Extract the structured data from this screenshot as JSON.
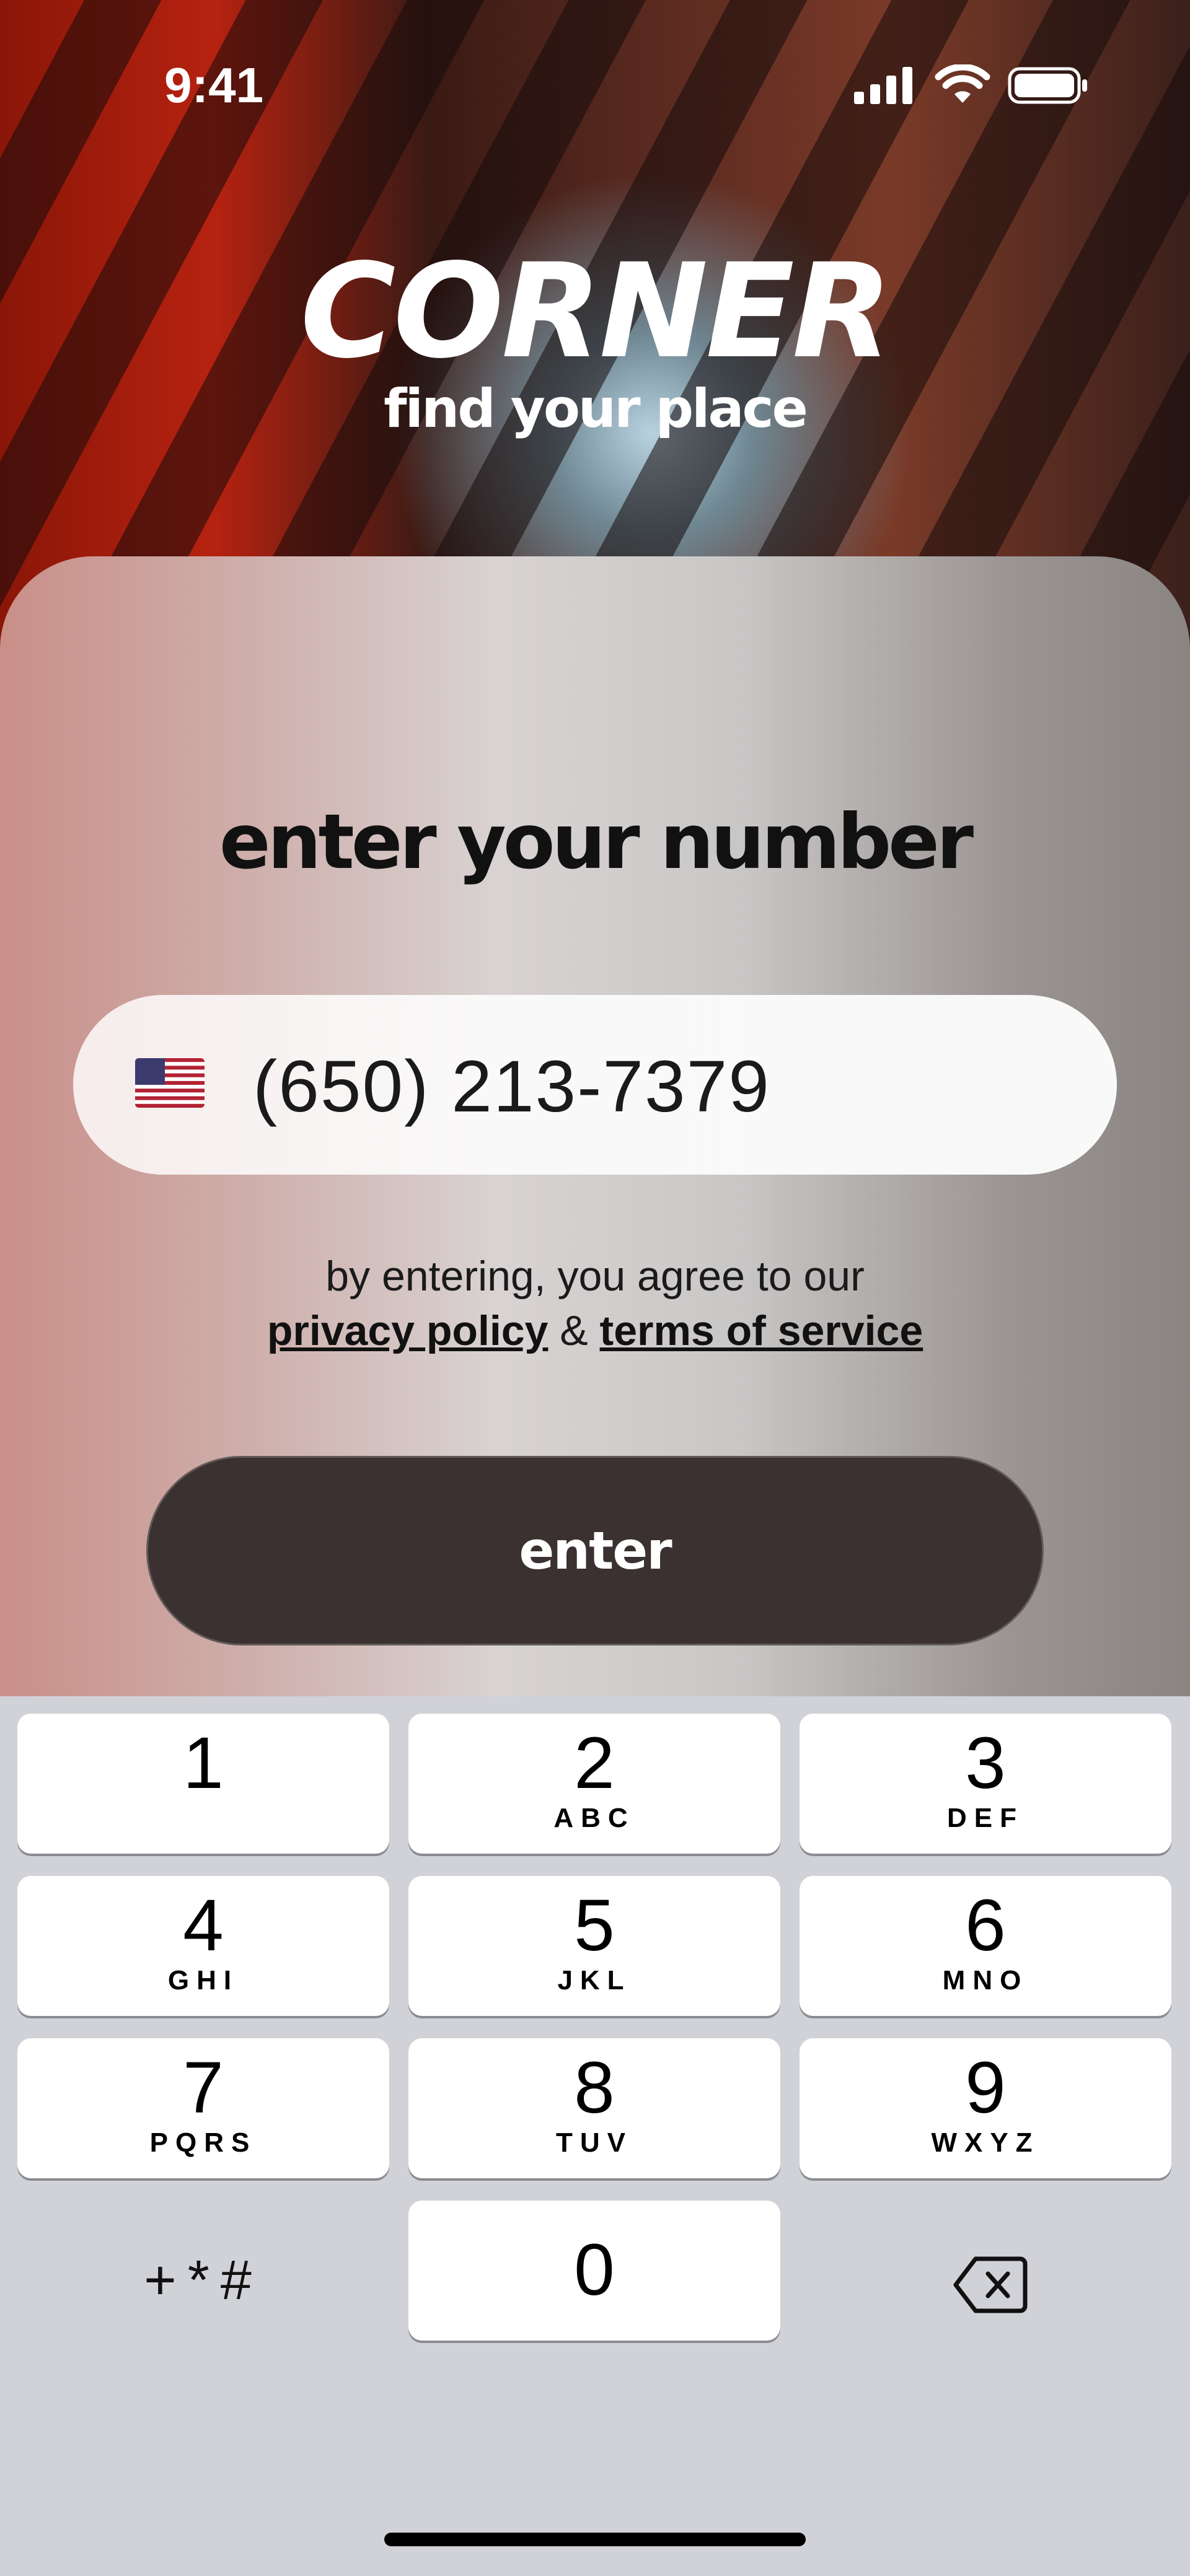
{
  "status": {
    "time": "9:41"
  },
  "brand": {
    "logo": "CORNER",
    "tagline": "find your place"
  },
  "sheet": {
    "title": "enter your number",
    "phone": {
      "value": "(650) 213-7379",
      "country_flag": "us-flag-icon"
    },
    "agree_prefix": "by entering, you agree to our",
    "privacy_label": "privacy policy",
    "amp": "&",
    "terms_label": "terms of service",
    "enter_label": "enter"
  },
  "keypad": {
    "keys": [
      {
        "num": "1",
        "letters": ""
      },
      {
        "num": "2",
        "letters": "ABC"
      },
      {
        "num": "3",
        "letters": "DEF"
      },
      {
        "num": "4",
        "letters": "GHI"
      },
      {
        "num": "5",
        "letters": "JKL"
      },
      {
        "num": "6",
        "letters": "MNO"
      },
      {
        "num": "7",
        "letters": "PQRS"
      },
      {
        "num": "8",
        "letters": "TUV"
      },
      {
        "num": "9",
        "letters": "WXYZ"
      },
      {
        "num": "0",
        "letters": ""
      }
    ],
    "symbols": "+*#"
  }
}
